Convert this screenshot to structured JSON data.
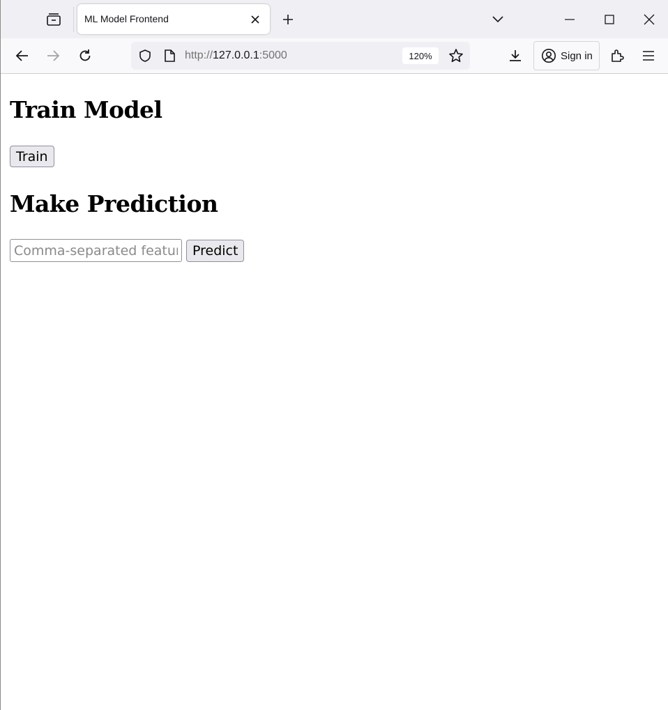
{
  "browser": {
    "tab_title": "ML Model Frontend",
    "url_scheme": "http://",
    "url_host": "127.0.0.1",
    "url_port": ":5000",
    "zoom": "120%",
    "signin_label": "Sign in"
  },
  "page": {
    "train_heading": "Train Model",
    "train_button": "Train",
    "predict_heading": "Make Prediction",
    "features_placeholder": "Comma-separated features",
    "predict_button": "Predict"
  }
}
